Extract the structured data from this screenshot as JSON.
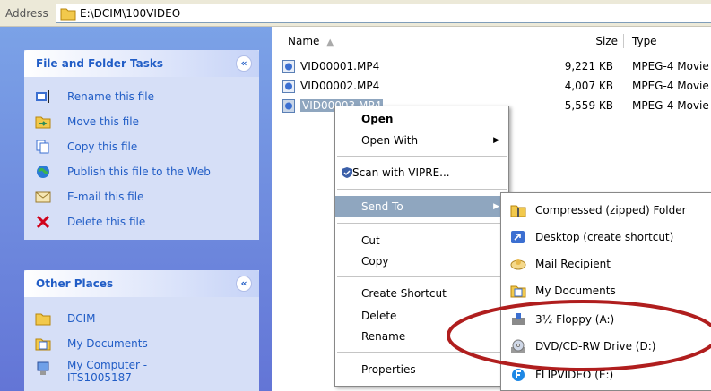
{
  "address": {
    "label": "Address",
    "path": "E:\\DCIM\\100VIDEO"
  },
  "task_pane": {
    "file_tasks": {
      "title": "File and Folder Tasks",
      "collapse": "«",
      "items": [
        {
          "label": "Rename this file",
          "icon": "rename-icon"
        },
        {
          "label": "Move this file",
          "icon": "move-icon"
        },
        {
          "label": "Copy this file",
          "icon": "copy-icon"
        },
        {
          "label": "Publish this file to the Web",
          "icon": "web-publish-icon"
        },
        {
          "label": "E-mail this file",
          "icon": "email-icon"
        },
        {
          "label": "Delete this file",
          "icon": "delete-icon"
        }
      ]
    },
    "other_places": {
      "title": "Other Places",
      "collapse": "«",
      "items": [
        {
          "label": "DCIM",
          "icon": "folder-icon"
        },
        {
          "label": "My Documents",
          "icon": "documents-icon"
        },
        {
          "label": "My Computer -",
          "label2": "ITS1005187",
          "icon": "computer-icon"
        }
      ]
    }
  },
  "file_list": {
    "columns": {
      "name": "Name",
      "size": "Size",
      "type": "Type",
      "sort_arrow": "▲"
    },
    "rows": [
      {
        "name": "VID00001.MP4",
        "size": "9,221 KB",
        "type": "MPEG-4 Movie"
      },
      {
        "name": "VID00002.MP4",
        "size": "4,007 KB",
        "type": "MPEG-4 Movie"
      },
      {
        "name": "VID00003.MP4",
        "size": "5,559 KB",
        "type": "MPEG-4 Movie"
      }
    ]
  },
  "context_menu": {
    "open": "Open",
    "open_with": "Open With",
    "scan": "Scan with VIPRE...",
    "send_to": "Send To",
    "cut": "Cut",
    "copy": "Copy",
    "create_shortcut": "Create Shortcut",
    "delete": "Delete",
    "rename": "Rename",
    "properties": "Properties",
    "submenu_arrow": "▶"
  },
  "send_to_menu": {
    "items": [
      {
        "label": "Compressed (zipped) Folder",
        "icon": "zip-folder-icon"
      },
      {
        "label": "Desktop (create shortcut)",
        "icon": "desktop-icon"
      },
      {
        "label": "Mail Recipient",
        "icon": "mail-icon"
      },
      {
        "label": "My Documents",
        "icon": "documents-icon"
      },
      {
        "label": "3½ Floppy (A:)",
        "icon": "floppy-icon"
      },
      {
        "label": "DVD/CD-RW Drive (D:)",
        "icon": "dvd-drive-icon"
      },
      {
        "label": "FLIPVIDEO (E:)",
        "icon": "flipvideo-icon"
      }
    ]
  },
  "colors": {
    "task_link": "#215dc6",
    "selection": "#8fa6bf",
    "annotation": "#b01e1e"
  }
}
